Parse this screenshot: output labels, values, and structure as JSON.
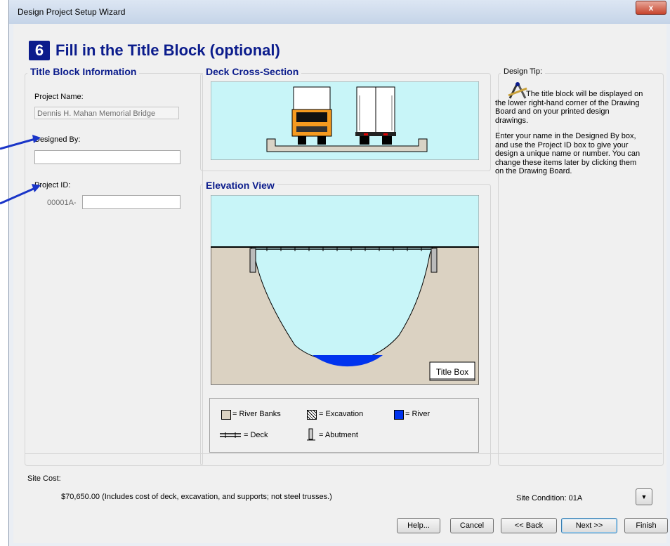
{
  "window": {
    "title": "Design Project Setup Wizard",
    "close": "x"
  },
  "step": {
    "number": "6",
    "title": "Fill in the Title Block (optional)"
  },
  "title_block": {
    "heading": "Title Block Information",
    "project_name_label": "Project Name:",
    "project_name_value": "Dennis H. Mahan Memorial Bridge",
    "designed_by_label": "Designed By:",
    "designed_by_value": "",
    "project_id_label": "Project ID:",
    "project_id_prefix": "00001A-",
    "project_id_value": ""
  },
  "deck": {
    "heading": "Deck Cross-Section"
  },
  "elevation": {
    "heading": "Elevation View",
    "title_box": "Title Box"
  },
  "legend": {
    "river_banks": "= River Banks",
    "excavation": "= Excavation",
    "river": "= River",
    "deck": "= Deck",
    "abutment": "= Abutment"
  },
  "tip": {
    "heading": "Design Tip:",
    "para1": "The title block will be displayed on the lower right-hand corner of the Drawing Board and on your printed design drawings.",
    "para2": "Enter your name in the Designed By box, and use the Project ID box to give your design a unique name or number. You can change these items later by clicking them on the Drawing Board."
  },
  "site": {
    "label": "Site Cost:",
    "cost": "$70,650.00  (Includes cost of deck, excavation, and supports; not steel trusses.)",
    "condition": "Site Condition: 01A"
  },
  "buttons": {
    "help": "Help...",
    "cancel": "Cancel",
    "back": "<< Back",
    "next": "Next >>",
    "finish": "Finish"
  },
  "colors": {
    "heading": "#0b1c8c",
    "sky": "#c8f5f8",
    "bank": "#dbd2c2",
    "river": "#0033ee",
    "accent_arrow": "#1a35c8"
  }
}
